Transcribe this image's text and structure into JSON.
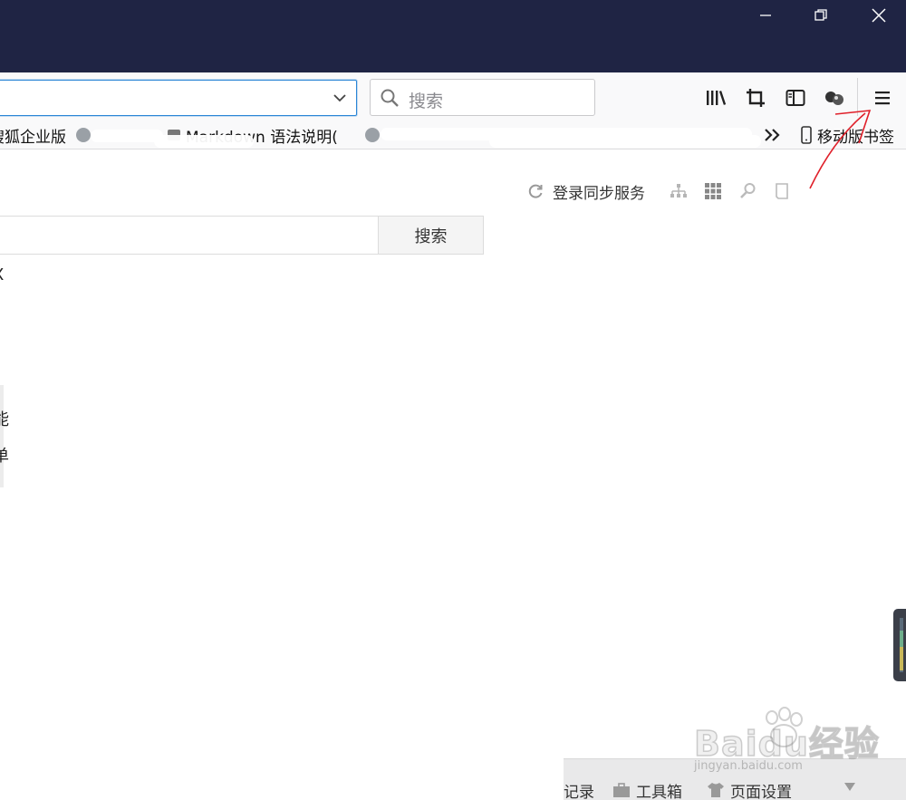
{
  "window": {
    "minimize_icon": "minimize-icon",
    "restore_icon": "restore-icon",
    "close_icon": "close-icon"
  },
  "toolbar": {
    "url_value": "",
    "search_placeholder": "搜索",
    "icons": [
      "library-icon",
      "screenshot-crop-icon",
      "sidebar-icon",
      "extension-icon",
      "hamburger-menu-icon"
    ]
  },
  "bookmarks": {
    "items": [
      {
        "label": "搜狐企业版",
        "icon": "globe-icon"
      },
      {
        "label": "Markdown 语法说明(",
        "icon": "page-icon"
      },
      {
        "label": "",
        "icon": "globe-icon"
      }
    ],
    "overflow_icon": "chevron-double-right-icon",
    "mobile_label": "移动版书签"
  },
  "header": {
    "sync_label": "登录同步服务",
    "icons": [
      "sitemap-icon",
      "grid-icon",
      "key-icon",
      "bookmark-page-icon"
    ]
  },
  "main": {
    "search_value": "",
    "search_button": "搜索",
    "side_fragments": [
      "X",
      "能",
      "单"
    ]
  },
  "bottom_bar": {
    "items": [
      "记录",
      "工具箱",
      "页面设置"
    ]
  },
  "watermark": {
    "text": "Baidu经验",
    "sub": "jingyan.baidu.com"
  },
  "colors": {
    "titlebar": "#1f2444",
    "focus": "#2b86d6",
    "annotation_arrow": "#e0202a"
  }
}
